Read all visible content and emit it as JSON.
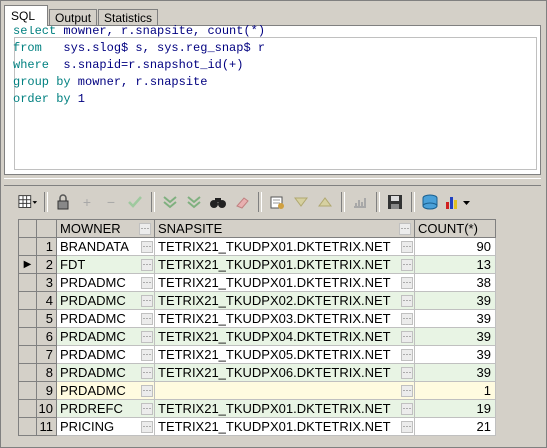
{
  "tabs": [
    {
      "label": "SQL"
    },
    {
      "label": "Output"
    },
    {
      "label": "Statistics"
    }
  ],
  "sql": {
    "lines": [
      {
        "kw": "select",
        "rest": " mowner, r.snapsite, count(*)"
      },
      {
        "kw": "from",
        "rest": "   sys.slog$ s, sys.reg_snap$ r"
      },
      {
        "kw": "where",
        "rest": "  s.snapid=r.snapshot_id(+)"
      },
      {
        "kw": "group by",
        "rest": " mowner, r.snapsite"
      },
      {
        "kw": "order by",
        "rest": " 1"
      }
    ]
  },
  "grid": {
    "columns": [
      "MOWNER",
      "SNAPSITE",
      "COUNT(*)"
    ],
    "ellipsis": "···",
    "rows": [
      {
        "n": "1",
        "mowner": "BRANDATA",
        "snapsite": "TETRIX21_TKUDPX01.DKTETRIX.NET",
        "count": "90"
      },
      {
        "n": "2",
        "mowner": "FDT",
        "snapsite": "TETRIX21_TKUDPX01.DKTETRIX.NET",
        "count": "13"
      },
      {
        "n": "3",
        "mowner": "PRDADMC",
        "snapsite": "TETRIX21_TKUDPX01.DKTETRIX.NET",
        "count": "38"
      },
      {
        "n": "4",
        "mowner": "PRDADMC",
        "snapsite": "TETRIX21_TKUDPX02.DKTETRIX.NET",
        "count": "39"
      },
      {
        "n": "5",
        "mowner": "PRDADMC",
        "snapsite": "TETRIX21_TKUDPX03.DKTETRIX.NET",
        "count": "39"
      },
      {
        "n": "6",
        "mowner": "PRDADMC",
        "snapsite": "TETRIX21_TKUDPX04.DKTETRIX.NET",
        "count": "39"
      },
      {
        "n": "7",
        "mowner": "PRDADMC",
        "snapsite": "TETRIX21_TKUDPX05.DKTETRIX.NET",
        "count": "39"
      },
      {
        "n": "8",
        "mowner": "PRDADMC",
        "snapsite": "TETRIX21_TKUDPX06.DKTETRIX.NET",
        "count": "39"
      },
      {
        "n": "9",
        "mowner": "PRDADMC",
        "snapsite": "",
        "count": "1"
      },
      {
        "n": "10",
        "mowner": "PRDREFC",
        "snapsite": "TETRIX21_TKUDPX01.DKTETRIX.NET",
        "count": "19"
      },
      {
        "n": "11",
        "mowner": "PRICING",
        "snapsite": "TETRIX21_TKUDPX01.DKTETRIX.NET",
        "count": "21"
      }
    ]
  },
  "toolbar_icons": [
    "grid-menu-icon",
    "lock-icon",
    "add-row-icon",
    "delete-row-icon",
    "post-edit-icon",
    "filter-icon",
    "clear-filter-icon",
    "find-icon",
    "eraser-icon",
    "export-icon",
    "sort-desc-icon",
    "sort-asc-icon",
    "chart-disabled-icon",
    "save-icon",
    "database-icon",
    "chart-icon"
  ],
  "colors": {
    "keyword": "#008080",
    "text": "#000080",
    "even_row": "#e8f4e4",
    "empty_row": "#fffbe0"
  }
}
